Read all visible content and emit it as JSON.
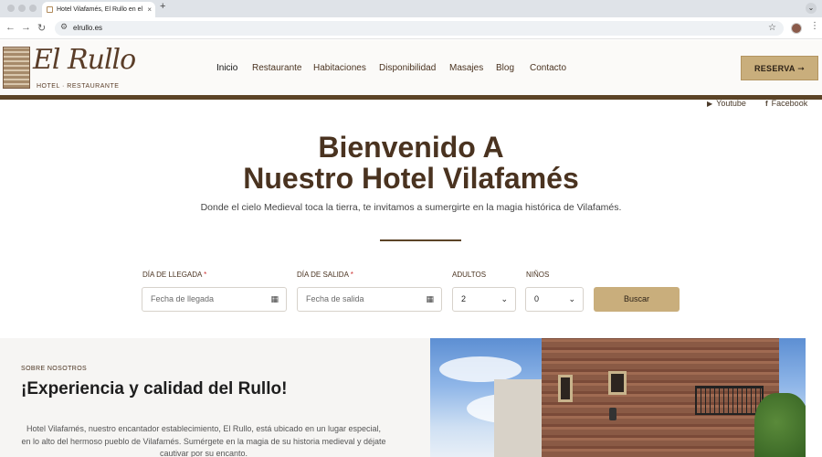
{
  "browser": {
    "tab_title": "Hotel Vilafamés, El Rullo en el",
    "tab_close": "×",
    "new_tab": "+",
    "url": "elrullo.es"
  },
  "header": {
    "logo_main": "El Rullo",
    "logo_sub": "HOTEL · RESTAURANTE",
    "nav": [
      "Inicio",
      "Restaurante",
      "Habitaciones",
      "Disponibilidad",
      "Masajes",
      "Blog",
      "Contacto"
    ],
    "reserva_label": "RESERVA",
    "reserva_arrow": "➞"
  },
  "social": {
    "youtube": "Youtube",
    "facebook": "Facebook"
  },
  "hero": {
    "title_line1": "Bienvenido A",
    "title_line2": "Nuestro Hotel Vilafamés",
    "subtitle": "Donde el cielo Medieval toca la tierra, te invitamos a sumergirte en la magia histórica de Vilafamés."
  },
  "booking": {
    "arrival_label": "DÍA DE LLEGADA",
    "arrival_placeholder": "Fecha de llegada",
    "departure_label": "DÍA DE SALIDA",
    "departure_placeholder": "Fecha de salida",
    "required_mark": "*",
    "adults_label": "ADULTOS",
    "adults_value": "2",
    "children_label": "NIÑOS",
    "children_value": "0",
    "search_label": "Buscar"
  },
  "about": {
    "eyebrow": "SOBRE NOSOTROS",
    "title": "¡Experiencia y calidad del Rullo!",
    "body": "Hotel Vilafamés, nuestro encantador establecimiento, El Rullo, está ubicado en un lugar especial, en lo alto del hermoso pueblo de Vilafamés. Sumérgete en la magia de su historia medieval y déjate cautivar por su encanto."
  },
  "colors": {
    "brand_brown": "#5c4427",
    "gold": "#c9ae7c"
  }
}
